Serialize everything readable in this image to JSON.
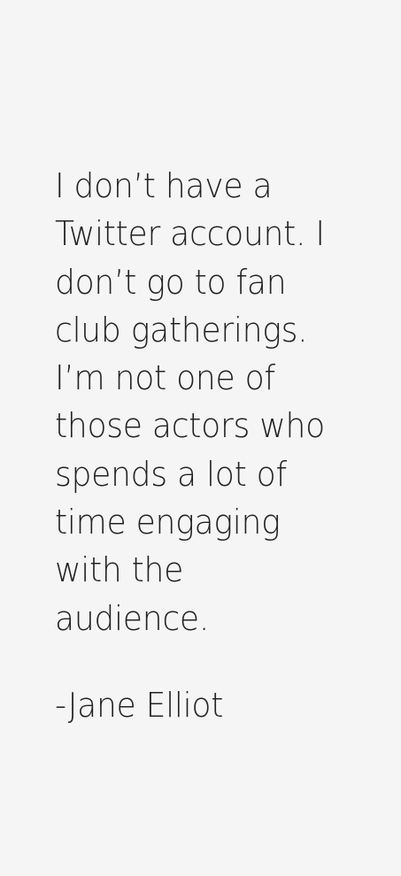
{
  "quote": {
    "lines": [
      "I don’t have a",
      "Twitter account. I",
      "don’t go to fan",
      "club gatherings.",
      "I’m not one of",
      "those actors who",
      "spends a lot of",
      "time engaging",
      "with the",
      "audience."
    ],
    "attribution": "-Jane Elliot"
  }
}
